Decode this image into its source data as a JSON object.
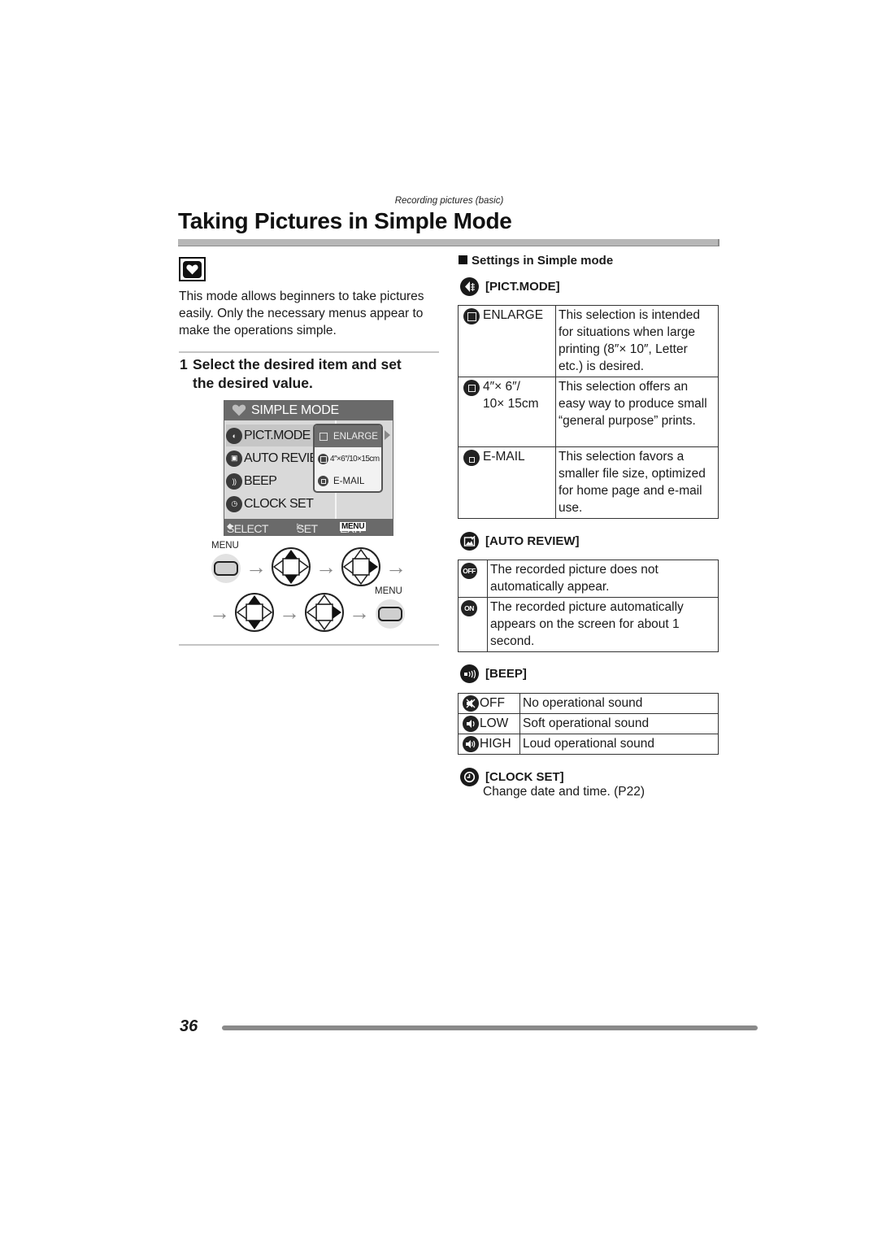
{
  "header": {
    "section": "Recording pictures (basic)",
    "title": "Taking Pictures in Simple Mode"
  },
  "mode_icon": "heart-icon",
  "intro": "This mode allows beginners to take pictures easily. Only the necessary menus appear to make the operations simple.",
  "step": {
    "number": "1",
    "line1": "Select the desired item and set",
    "line2": "the desired value."
  },
  "lcd": {
    "title": "SIMPLE MODE",
    "items": [
      {
        "label": "PICT.MODE",
        "icon": "pict-mode-icon",
        "selected": true
      },
      {
        "label": "AUTO REVIE",
        "icon": "auto-review-icon",
        "selected": false
      },
      {
        "label": "BEEP",
        "icon": "beep-icon",
        "selected": false
      },
      {
        "label": "CLOCK SET",
        "icon": "clock-icon",
        "selected": false
      }
    ],
    "popup": [
      {
        "label": "ENLARGE",
        "selected": true
      },
      {
        "label": "4″×6″/10×15cm",
        "selected": false
      },
      {
        "label": "E-MAIL",
        "selected": false
      }
    ],
    "footer": {
      "select": "SELECT",
      "set": "SET",
      "exit": "EXIT",
      "menu": "MENU"
    }
  },
  "controls": {
    "menu_label_start": "MENU",
    "menu_label_end": "MENU",
    "sequence": [
      "menu-button",
      "up-down",
      "right",
      "up-down",
      "right",
      "menu-button"
    ]
  },
  "settings": {
    "heading": "Settings in Simple mode",
    "pict_mode": {
      "title": "[PICT.MODE]",
      "rows": [
        {
          "option": "ENLARGE",
          "description": "This selection is intended for situations when large printing (8″× 10″, Letter etc.) is desired."
        },
        {
          "option_line1": "4″× 6″/",
          "option_line2": "10× 15cm",
          "description": "This selection offers an easy way to produce small “general purpose” prints."
        },
        {
          "option": "E-MAIL",
          "description": "This selection favors a smaller file size, optimized for home page and e-mail use."
        }
      ]
    },
    "auto_review": {
      "title": "[AUTO REVIEW]",
      "rows": [
        {
          "badge": "OFF",
          "description": "The recorded picture does not automatically appear."
        },
        {
          "badge": "ON",
          "description": "The recorded picture automatically appears on the screen for about 1 second."
        }
      ]
    },
    "beep": {
      "title": "[BEEP]",
      "rows": [
        {
          "option": "OFF",
          "description": "No operational sound"
        },
        {
          "option": "LOW",
          "description": "Soft operational sound"
        },
        {
          "option": "HIGH",
          "description": "Loud operational sound"
        }
      ]
    },
    "clock_set": {
      "title": "[CLOCK SET]",
      "description": "Change date and time. (P22)"
    }
  },
  "page_number": "36"
}
